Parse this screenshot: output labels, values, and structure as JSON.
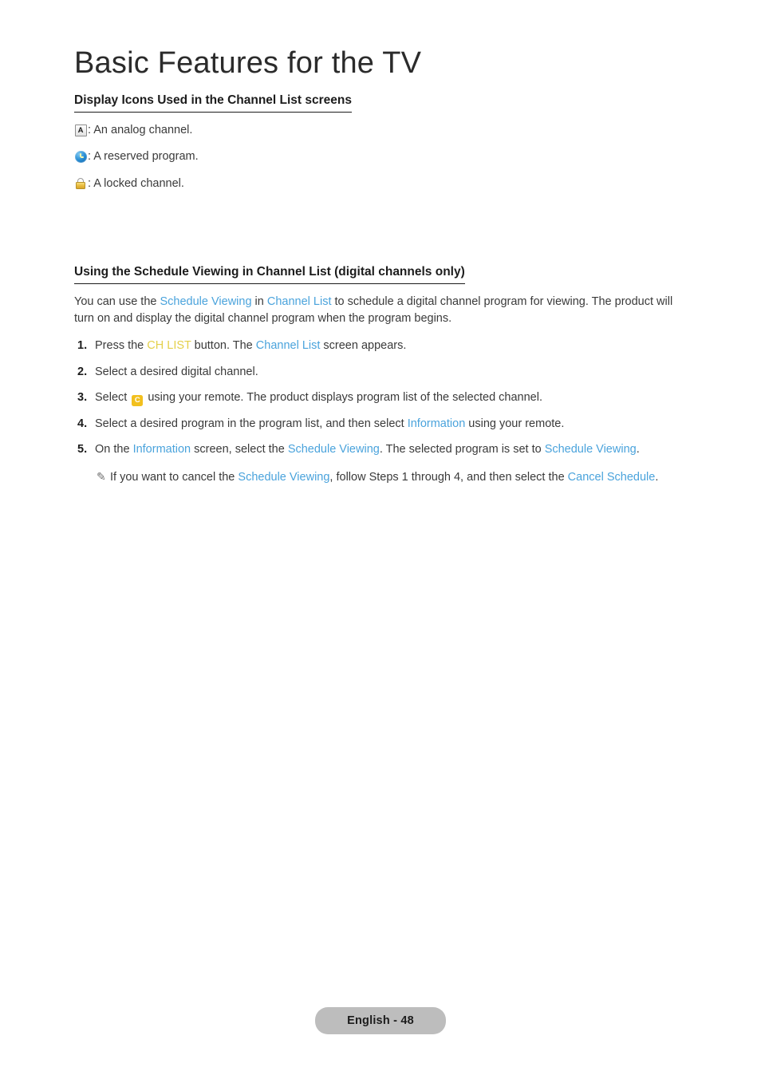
{
  "page": {
    "title": "Basic Features for the TV"
  },
  "section_icons": {
    "heading": "Display Icons Used in the Channel List screens",
    "items": [
      {
        "icon": "analog-channel-icon",
        "icon_label": "A",
        "text": ": An analog channel."
      },
      {
        "icon": "reserved-program-clock-icon",
        "icon_label": "",
        "text": ": A reserved program."
      },
      {
        "icon": "locked-channel-padlock-icon",
        "icon_label": "",
        "text": ": A locked channel."
      }
    ]
  },
  "section_schedule": {
    "heading": "Using the Schedule Viewing in Channel List (digital channels only)",
    "intro": {
      "part1": "You can use the ",
      "term1": "Schedule Viewing",
      "part2": " in ",
      "term2": "Channel List",
      "part3": " to schedule a digital channel program for viewing. The product will turn on and display the digital channel program when the program begins."
    },
    "steps": [
      {
        "number": "1.",
        "part1": "Press the ",
        "term1": "CH LIST",
        "part2": " button. The ",
        "term2": "Channel List",
        "part3": " screen appears."
      },
      {
        "number": "2.",
        "part1": "Select a desired digital channel.",
        "term1": "",
        "part2": "",
        "term2": "",
        "part3": ""
      },
      {
        "number": "3.",
        "part1": "Select ",
        "key_badge": "C",
        "part2": " using your remote. The product displays program list of the selected channel.",
        "term1": "",
        "term2": "",
        "part3": ""
      },
      {
        "number": "4.",
        "part1": "Select a desired program in the program list, and then select ",
        "term1": "Information",
        "part2": " using your remote.",
        "term2": "",
        "part3": ""
      },
      {
        "number": "5.",
        "part1": "On the ",
        "term1": "Information",
        "part2": " screen, select the ",
        "term2": "Schedule Viewing",
        "part3": ". The selected program is set to ",
        "term3": "Schedule Viewing",
        "part4": "."
      }
    ],
    "note": {
      "icon": "pencil-note-icon",
      "glyph": "✎",
      "part1": " If you want to cancel the ",
      "term1": "Schedule Viewing",
      "part2": ", follow Steps 1 through 4, and then select the ",
      "term2": "Cancel Schedule",
      "part3": "."
    }
  },
  "footer": {
    "label": "English - 48"
  },
  "colors": {
    "link_blue": "#4aa3dc",
    "key_yellow": "#e4d04a",
    "badge_yellow": "#f2c01e",
    "footer_pill": "#bdbdbd",
    "body_text": "#3a3a3a"
  }
}
